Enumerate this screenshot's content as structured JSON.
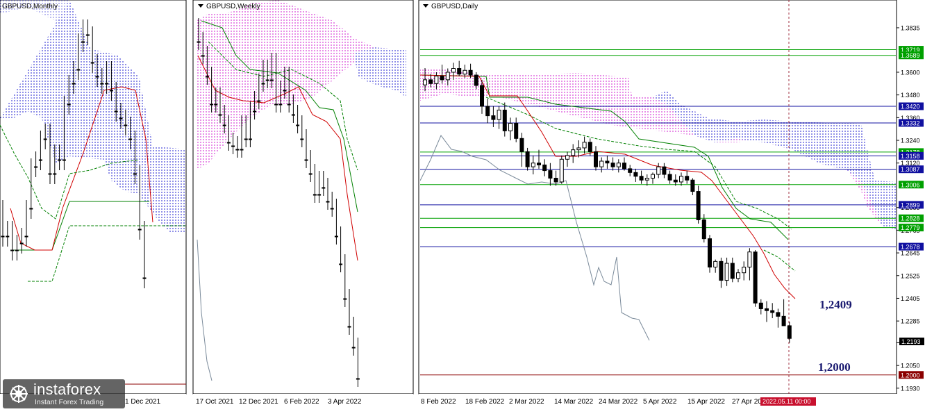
{
  "panels": {
    "monthly": {
      "title": "GBPUSD,Monthly",
      "dates": [
        "1 Dec 2021"
      ]
    },
    "weekly": {
      "title": "GBPUSD,Weekly",
      "dates": [
        "17 Oct 2021",
        "12 Dec 2021",
        "6 Feb 2022",
        "3 Apr 2022"
      ]
    },
    "daily": {
      "title": "GBPUSD,Daily",
      "dates": [
        "8 Feb 2022",
        "18 Feb 2022",
        "2 Mar 2022",
        "14 Mar 2022",
        "24 Mar 2022",
        "5 Apr 2022",
        "15 Apr 2022",
        "27 Apr 20"
      ],
      "current_time": "2022.05.11 00:00"
    }
  },
  "annotations": {
    "upper": "1,2409",
    "lower": "1,2000"
  },
  "watermark": {
    "brand": "instaforex",
    "tagline": "Instant Forex Trading"
  },
  "colors": {
    "green_level": "#00a000",
    "blue_level": "#1010a0",
    "dark_red": "#8b0000",
    "cloud_pink": "#d020d0",
    "cloud_blue": "#2020d0",
    "tenkan": "#d00000",
    "kijun": "#008000",
    "chikou": "#7a8a9a",
    "annotation": "#191970"
  },
  "chart_data": [
    {
      "type": "candlestick",
      "panel": "GBPUSD,Monthly",
      "x": [
        "1 Dec 2021"
      ],
      "indicator": "Ichimoku"
    },
    {
      "type": "candlestick",
      "panel": "GBPUSD,Weekly",
      "x": [
        "17 Oct 2021",
        "12 Dec 2021",
        "6 Feb 2022",
        "3 Apr 2022"
      ],
      "indicator": "Ichimoku"
    },
    {
      "type": "candlestick",
      "panel": "GBPUSD,Daily",
      "indicator": "Ichimoku",
      "x": [
        "8 Feb 2022",
        "18 Feb 2022",
        "2 Mar 2022",
        "14 Mar 2022",
        "24 Mar 2022",
        "5 Apr 2022",
        "15 Apr 2022",
        "27 Apr 20"
      ],
      "y_ticks": [
        "1.3835",
        "1.3600",
        "1.3480",
        "1.3360",
        "1.3240",
        "1.3120",
        "1.2885",
        "1.2765",
        "1.2645",
        "1.2525",
        "1.2405",
        "1.2285",
        "1.2170",
        "1.2050",
        "1.1930"
      ],
      "ylim": [
        1.19,
        1.3945
      ],
      "levels": [
        {
          "value": "1.3719",
          "color": "green"
        },
        {
          "value": "1.3689",
          "color": "green"
        },
        {
          "value": "1.3420",
          "color": "blue"
        },
        {
          "value": "1.3332",
          "color": "blue"
        },
        {
          "value": "1.3178",
          "color": "green"
        },
        {
          "value": "1.3158",
          "color": "blue"
        },
        {
          "value": "1.3087",
          "color": "blue"
        },
        {
          "value": "1.3006",
          "color": "green"
        },
        {
          "value": "1.2899",
          "color": "blue"
        },
        {
          "value": "1.2828",
          "color": "green"
        },
        {
          "value": "1.2779",
          "color": "green"
        },
        {
          "value": "1.2678",
          "color": "blue"
        },
        {
          "value": "1.2000",
          "color": "red"
        }
      ],
      "last_price": "1.2193",
      "ohlc": [
        [
          1.3533,
          1.3622,
          1.35,
          1.356
        ],
        [
          1.356,
          1.359,
          1.352,
          1.354
        ],
        [
          1.354,
          1.36,
          1.351,
          1.358
        ],
        [
          1.358,
          1.364,
          1.354,
          1.356
        ],
        [
          1.356,
          1.362,
          1.353,
          1.36
        ],
        [
          1.36,
          1.365,
          1.356,
          1.362
        ],
        [
          1.362,
          1.366,
          1.358,
          1.359
        ],
        [
          1.359,
          1.364,
          1.357,
          1.361
        ],
        [
          1.361,
          1.3645,
          1.357,
          1.3585
        ],
        [
          1.3585,
          1.36,
          1.351,
          1.353
        ],
        [
          1.353,
          1.356,
          1.338,
          1.342
        ],
        [
          1.342,
          1.346,
          1.333,
          1.337
        ],
        [
          1.337,
          1.342,
          1.331,
          1.335
        ],
        [
          1.335,
          1.342,
          1.33,
          1.34
        ],
        [
          1.34,
          1.344,
          1.326,
          1.329
        ],
        [
          1.329,
          1.336,
          1.324,
          1.333
        ],
        [
          1.333,
          1.336,
          1.323,
          1.325
        ],
        [
          1.325,
          1.328,
          1.31,
          1.318
        ],
        [
          1.318,
          1.32,
          1.308,
          1.31
        ],
        [
          1.31,
          1.316,
          1.306,
          1.312
        ],
        [
          1.312,
          1.319,
          1.309,
          1.311
        ],
        [
          1.311,
          1.314,
          1.305,
          1.308
        ],
        [
          1.308,
          1.312,
          1.3,
          1.304
        ],
        [
          1.304,
          1.308,
          1.3,
          1.302
        ],
        [
          1.302,
          1.316,
          1.301,
          1.314
        ],
        [
          1.314,
          1.318,
          1.31,
          1.316
        ],
        [
          1.316,
          1.322,
          1.312,
          1.319
        ],
        [
          1.319,
          1.324,
          1.315,
          1.32
        ],
        [
          1.32,
          1.326,
          1.317,
          1.323
        ],
        [
          1.323,
          1.325,
          1.316,
          1.318
        ],
        [
          1.318,
          1.321,
          1.308,
          1.31
        ],
        [
          1.31,
          1.315,
          1.307,
          1.313
        ],
        [
          1.313,
          1.316,
          1.309,
          1.312
        ],
        [
          1.312,
          1.315,
          1.308,
          1.31
        ],
        [
          1.31,
          1.314,
          1.307,
          1.312
        ],
        [
          1.312,
          1.315,
          1.308,
          1.309
        ],
        [
          1.309,
          1.311,
          1.305,
          1.307
        ],
        [
          1.307,
          1.309,
          1.302,
          1.305
        ],
        [
          1.305,
          1.308,
          1.301,
          1.303
        ],
        [
          1.303,
          1.306,
          1.3,
          1.304
        ],
        [
          1.304,
          1.307,
          1.301,
          1.306
        ],
        [
          1.306,
          1.312,
          1.304,
          1.31
        ],
        [
          1.31,
          1.312,
          1.304,
          1.306
        ],
        [
          1.306,
          1.308,
          1.301,
          1.303
        ],
        [
          1.303,
          1.306,
          1.3,
          1.302
        ],
        [
          1.302,
          1.307,
          1.3,
          1.305
        ],
        [
          1.305,
          1.308,
          1.301,
          1.303
        ],
        [
          1.303,
          1.304,
          1.295,
          1.297
        ],
        [
          1.297,
          1.3,
          1.28,
          1.282
        ],
        [
          1.282,
          1.285,
          1.27,
          1.272
        ],
        [
          1.272,
          1.274,
          1.254,
          1.257
        ],
        [
          1.257,
          1.261,
          1.254,
          1.26
        ],
        [
          1.26,
          1.262,
          1.246,
          1.25
        ],
        [
          1.25,
          1.262,
          1.247,
          1.259
        ],
        [
          1.259,
          1.262,
          1.249,
          1.251
        ],
        [
          1.251,
          1.256,
          1.249,
          1.254
        ],
        [
          1.254,
          1.26,
          1.25,
          1.257
        ],
        [
          1.257,
          1.267,
          1.25,
          1.265
        ],
        [
          1.265,
          1.266,
          1.236,
          1.238
        ],
        [
          1.238,
          1.24,
          1.232,
          1.235
        ],
        [
          1.235,
          1.239,
          1.228,
          1.234
        ],
        [
          1.234,
          1.238,
          1.23,
          1.233
        ],
        [
          1.233,
          1.235,
          1.225,
          1.231
        ],
        [
          1.231,
          1.24,
          1.226,
          1.226
        ],
        [
          1.226,
          1.228,
          1.217,
          1.2193
        ]
      ]
    }
  ]
}
